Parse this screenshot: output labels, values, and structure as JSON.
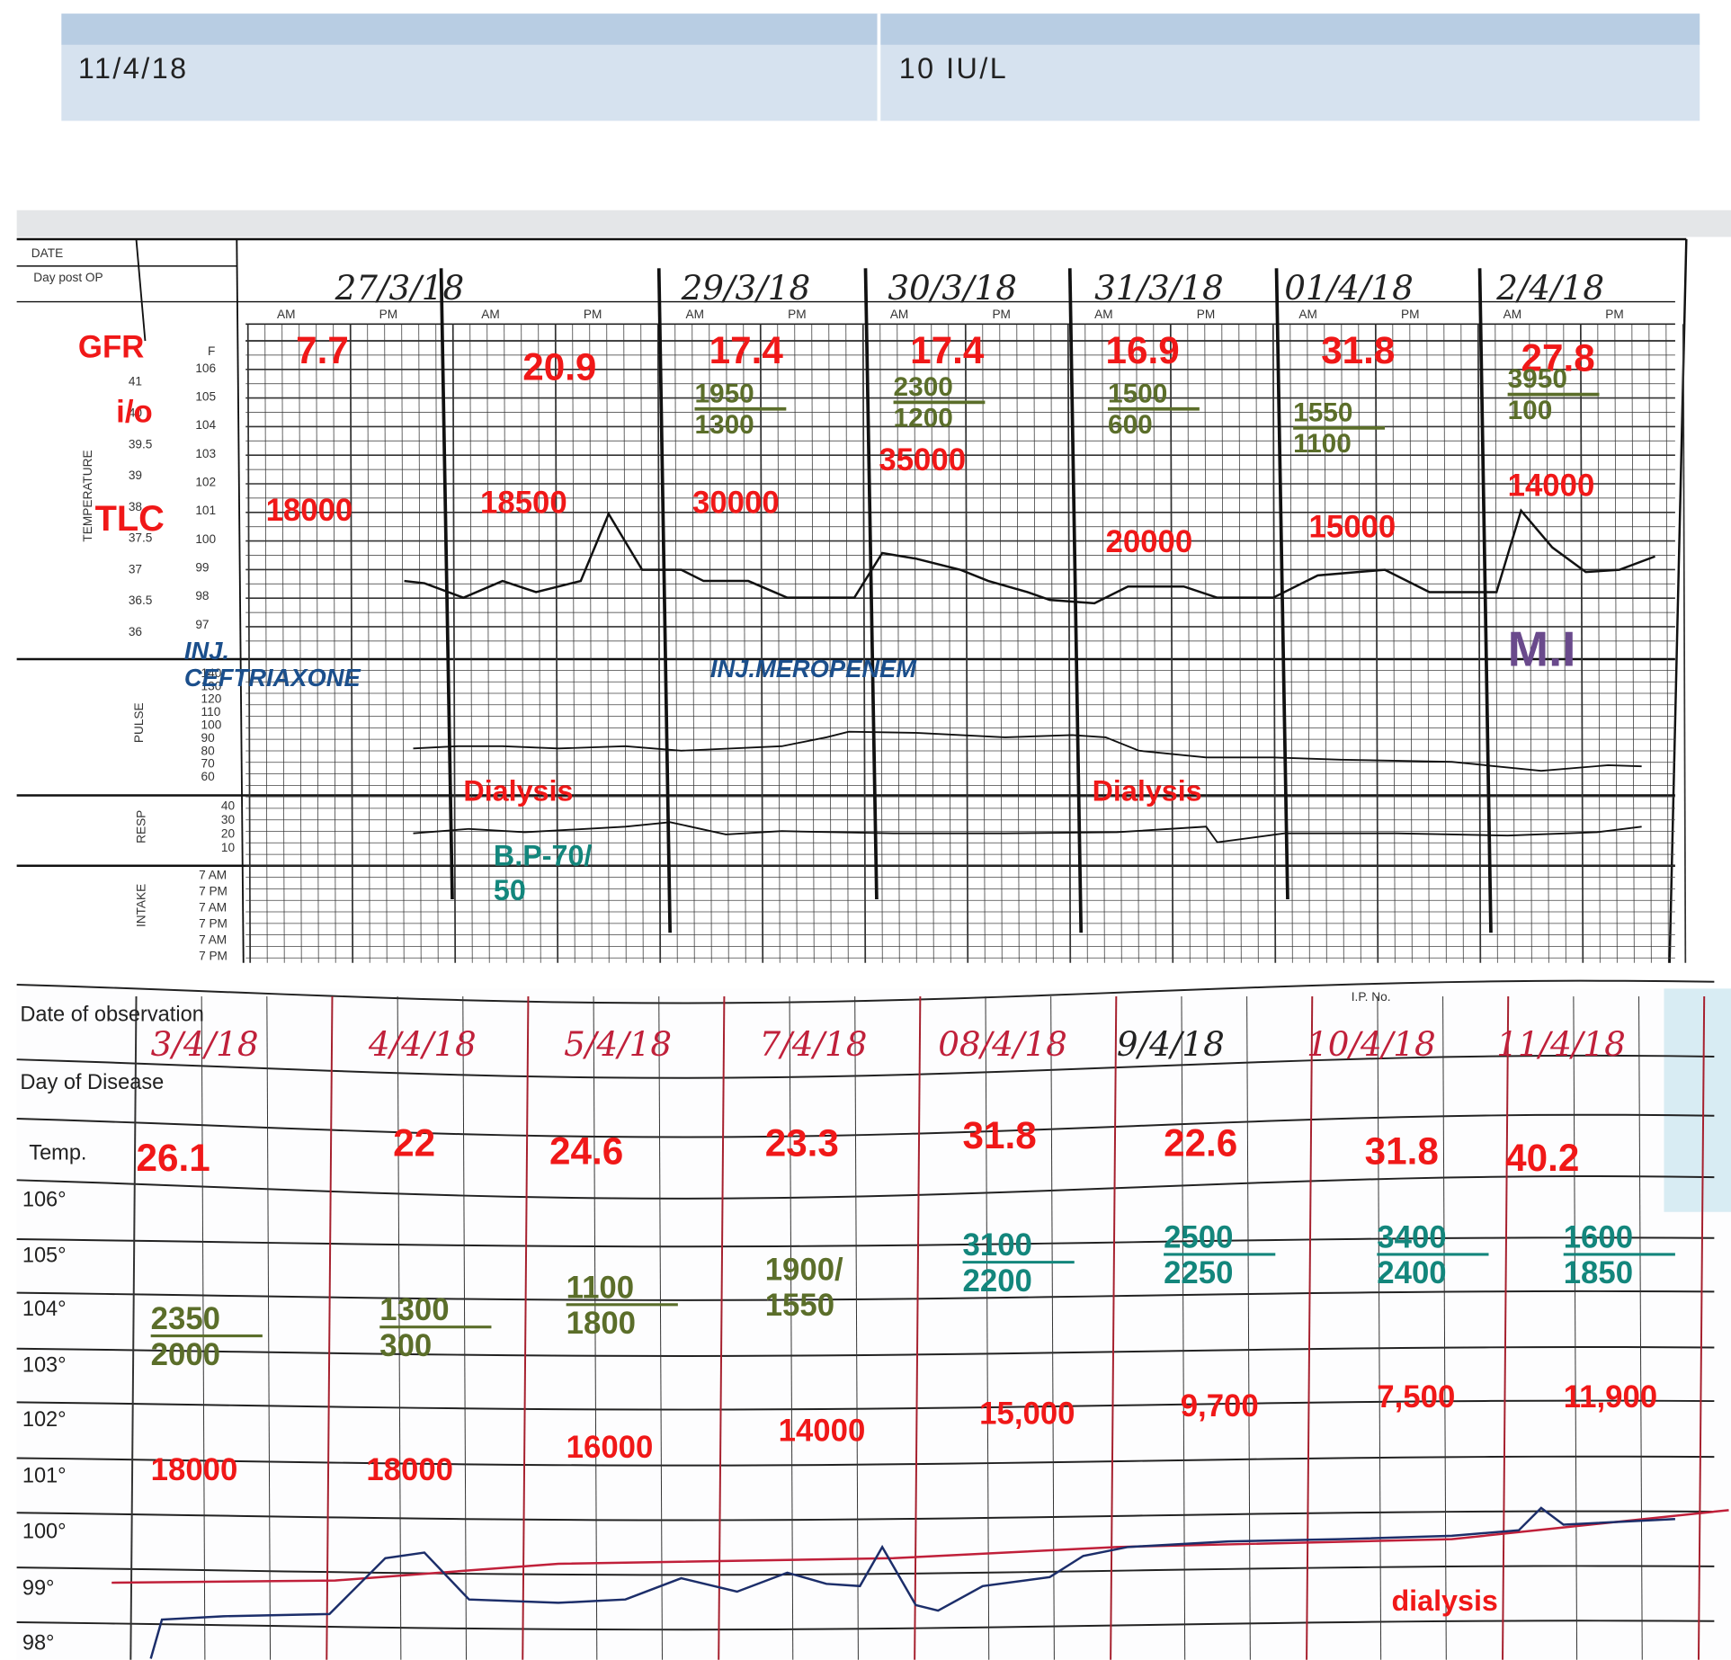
{
  "top_table": {
    "date": "11/4/18",
    "value": "10 IU/L"
  },
  "chart1": {
    "row_labels": {
      "date": "DATE",
      "day_post_op": "Day post OP",
      "temperature": "TEMPERATURE",
      "pulse": "PULSE",
      "resp": "RESP",
      "intake": "INTAKE",
      "f": "F"
    },
    "dates": [
      "27/3/18",
      "29/3/18",
      "30/3/18",
      "31/3/18",
      "01/4/18",
      "2/4/18"
    ],
    "am": "AM",
    "pm": "PM",
    "fahrenheit_scale": [
      "106",
      "105",
      "104",
      "103",
      "102",
      "101",
      "100",
      "99",
      "98",
      "97"
    ],
    "celsius_scale": [
      "41",
      "40",
      "39.5",
      "39",
      "38",
      "37.5",
      "37",
      "36.5",
      "36"
    ],
    "pulse_scale": [
      "140",
      "130",
      "120",
      "110",
      "100",
      "90",
      "80",
      "70",
      "60"
    ],
    "resp_scale": [
      "40",
      "30",
      "20",
      "10"
    ],
    "intake_times": [
      "7 AM",
      "7 PM",
      "7 AM",
      "7 PM",
      "7 AM",
      "7 PM"
    ],
    "labels": {
      "gfr": "GFR",
      "io": "i/o",
      "tlc": "TLC"
    },
    "gfr": [
      "7.7",
      "20.9",
      "17.4",
      "17.4",
      "16.9",
      "31.8",
      "27.8"
    ],
    "io": [
      {
        "in": "1950",
        "out": "1300"
      },
      {
        "in": "2300",
        "out": "1200"
      },
      {
        "in": "1500",
        "out": "600"
      },
      {
        "in": "1550",
        "out": "1100"
      },
      {
        "in": "3950",
        "out": "100"
      }
    ],
    "tlc": [
      "18000",
      "18500",
      "30000",
      "35000",
      "20000",
      "15000",
      "14000"
    ],
    "drugs": {
      "inj1": "INJ.",
      "ceftriaxone": "CEFTRIAXONE",
      "meropenem": "INJ.MEROPENEM"
    },
    "event_mi": "M.I",
    "dialysis": [
      "Dialysis",
      "Dialysis"
    ],
    "bp": [
      "B.P-70/",
      "50"
    ]
  },
  "chart2": {
    "row_labels": {
      "date": "Date of observation",
      "day": "Day of Disease",
      "temp": "Temp.",
      "ip_no": "I.P. No."
    },
    "temp_scale": [
      "106°",
      "105°",
      "104°",
      "103°",
      "102°",
      "101°",
      "100°",
      "99°",
      "98°"
    ],
    "dates": [
      "3/4/18",
      "4/4/18",
      "5/4/18",
      "7/4/18",
      "08/4/18",
      "9/4/18",
      "10/4/18",
      "11/4/18"
    ],
    "gfr": [
      "26.1",
      "22",
      "24.6",
      "23.3",
      "31.8",
      "22.6",
      "31.8",
      "40.2"
    ],
    "io": [
      {
        "in": "2350",
        "out": "2000"
      },
      {
        "in": "1300",
        "out": "300"
      },
      {
        "in": "1100",
        "out": "1800"
      },
      {
        "in": "1900/",
        "out": "1550"
      },
      {
        "in": "3100",
        "out": "2200"
      },
      {
        "in": "2500",
        "out": "2250"
      },
      {
        "in": "3400",
        "out": "2400"
      },
      {
        "in": "1600",
        "out": "1850"
      }
    ],
    "tlc": [
      "18000",
      "18000",
      "16000",
      "14000",
      "15,000",
      "9,700",
      "7,500",
      "11,900"
    ],
    "dialysis": "dialysis",
    "colors": {
      "red": "#f01818",
      "green": "#5b6e2a",
      "teal": "#13867c"
    }
  }
}
